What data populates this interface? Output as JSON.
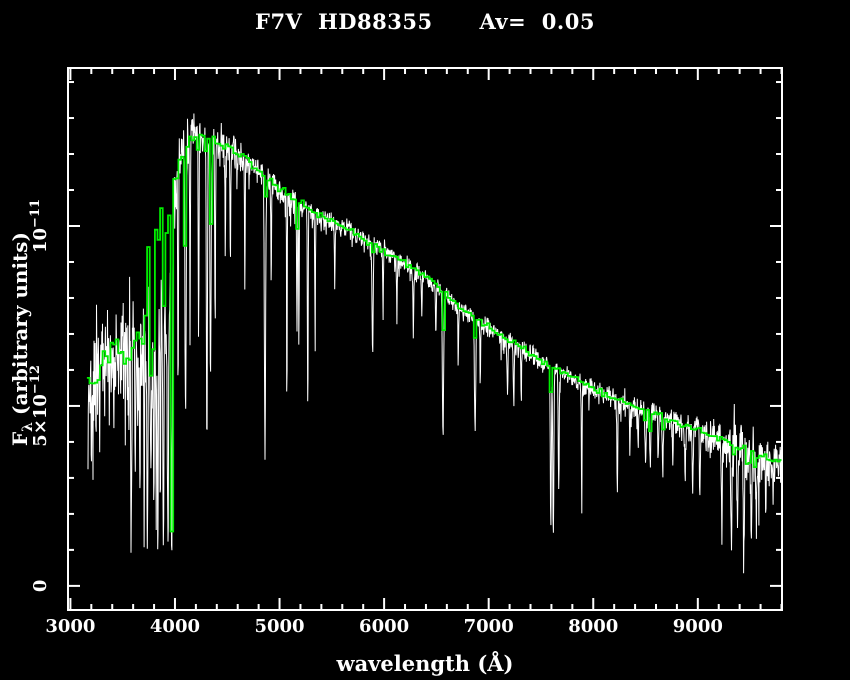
{
  "window": {
    "background": "#000000",
    "foreground": "#ffffff"
  },
  "chart_data": {
    "type": "line",
    "title": "F7V  HD88355      Av=  0.05",
    "xlabel": "wavelength (Å)",
    "ylabel_parts": [
      {
        "t": "F"
      },
      {
        "t": "λ",
        "sub": true
      },
      {
        "t": " (arbitrary units)"
      }
    ],
    "axis_color": "#ffffff",
    "background_color": "#000000",
    "x_range": [
      2977,
      9805
    ],
    "x_unit": "Å",
    "x_major_ticks": [
      {
        "value": 3000,
        "label": "3000"
      },
      {
        "value": 4000,
        "label": "4000"
      },
      {
        "value": 5000,
        "label": "5000"
      },
      {
        "value": 6000,
        "label": "6000"
      },
      {
        "value": 7000,
        "label": "7000"
      },
      {
        "value": 8000,
        "label": "8000"
      },
      {
        "value": 9000,
        "label": "9000"
      }
    ],
    "x_minor_step": 200,
    "y_range_1e12": [
      -0.67,
      14.39
    ],
    "y_major_ticks": [
      {
        "value": 0,
        "parts": [
          {
            "t": "0"
          }
        ]
      },
      {
        "value": 5,
        "parts": [
          {
            "t": "5×10"
          },
          {
            "t": "−12",
            "sup": true
          }
        ]
      },
      {
        "value": 10,
        "parts": [
          {
            "t": "10"
          },
          {
            "t": "−11",
            "sup": true
          }
        ]
      }
    ],
    "y_minor_step": 1,
    "y_minor_max": 14,
    "grid": false,
    "legend": false,
    "noise_seed": 7,
    "series": [
      {
        "name": "observed-spectrum",
        "color": "#ffffff",
        "style": "line",
        "stroke_width": 1,
        "start": 3168,
        "end": 9800,
        "sample_step_A": 3.4,
        "continuum_1e12": [
          [
            3168,
            5.0
          ],
          [
            3230,
            5.3
          ],
          [
            3300,
            5.8
          ],
          [
            3400,
            6.2
          ],
          [
            3500,
            6.4
          ],
          [
            3600,
            6.2
          ],
          [
            3700,
            6.6
          ],
          [
            3780,
            6.9
          ],
          [
            3860,
            7.1
          ],
          [
            3920,
            7.3
          ],
          [
            3960,
            8.6
          ],
          [
            4000,
            10.6
          ],
          [
            4040,
            11.8
          ],
          [
            4100,
            12.4
          ],
          [
            4160,
            12.7
          ],
          [
            4250,
            12.5
          ],
          [
            4350,
            12.3
          ],
          [
            4450,
            12.25
          ],
          [
            4550,
            12.1
          ],
          [
            4700,
            11.8
          ],
          [
            4850,
            11.4
          ],
          [
            5000,
            11.0
          ],
          [
            5200,
            10.6
          ],
          [
            5400,
            10.2
          ],
          [
            5600,
            10.0
          ],
          [
            5800,
            9.65
          ],
          [
            6000,
            9.3
          ],
          [
            6200,
            8.95
          ],
          [
            6450,
            8.45
          ],
          [
            6563,
            8.15
          ],
          [
            6700,
            7.75
          ],
          [
            6900,
            7.35
          ],
          [
            7100,
            7.0
          ],
          [
            7300,
            6.6
          ],
          [
            7500,
            6.25
          ],
          [
            7700,
            5.95
          ],
          [
            7900,
            5.6
          ],
          [
            8100,
            5.35
          ],
          [
            8300,
            5.1
          ],
          [
            8500,
            4.85
          ],
          [
            8700,
            4.6
          ],
          [
            8900,
            4.4
          ],
          [
            9100,
            4.15
          ],
          [
            9300,
            3.95
          ],
          [
            9500,
            3.7
          ],
          [
            9650,
            3.5
          ],
          [
            9800,
            3.4
          ]
        ],
        "noise_amplitude_1e12": [
          [
            3168,
            1.9
          ],
          [
            3500,
            2.0
          ],
          [
            3800,
            1.9
          ],
          [
            3950,
            1.5
          ],
          [
            4050,
            0.8
          ],
          [
            4200,
            0.55
          ],
          [
            4600,
            0.45
          ],
          [
            5000,
            0.38
          ],
          [
            5500,
            0.33
          ],
          [
            6000,
            0.3
          ],
          [
            6500,
            0.28
          ],
          [
            7000,
            0.3
          ],
          [
            7400,
            0.32
          ],
          [
            7800,
            0.35
          ],
          [
            8200,
            0.35
          ],
          [
            8700,
            0.4
          ],
          [
            9000,
            0.5
          ],
          [
            9200,
            0.7
          ],
          [
            9350,
            1.0
          ],
          [
            9550,
            1.0
          ],
          [
            9700,
            0.75
          ],
          [
            9800,
            0.6
          ]
        ],
        "absorption_lines": [
          [
            3581,
            1.3,
            6
          ],
          [
            3620,
            2.6,
            5
          ],
          [
            3664,
            2.9,
            5
          ],
          [
            3706,
            2.3,
            5
          ],
          [
            3735,
            1.1,
            6
          ],
          [
            3770,
            2.2,
            6
          ],
          [
            3798,
            2.0,
            6
          ],
          [
            3820,
            2.8,
            5
          ],
          [
            3835,
            1.6,
            6
          ],
          [
            3860,
            3.0,
            5
          ],
          [
            3889,
            1.2,
            7
          ],
          [
            3933,
            0.7,
            8
          ],
          [
            3968,
            1.0,
            8
          ],
          [
            4030,
            5.2,
            5
          ],
          [
            4101,
            4.8,
            8
          ],
          [
            4144,
            7.8,
            5
          ],
          [
            4226,
            6.8,
            5
          ],
          [
            4305,
            3.8,
            7
          ],
          [
            4340,
            5.9,
            8
          ],
          [
            4384,
            7.0,
            5
          ],
          [
            4481,
            9.2,
            4
          ],
          [
            4530,
            8.7,
            4
          ],
          [
            4668,
            8.2,
            4
          ],
          [
            4861,
            3.4,
            8
          ],
          [
            4920,
            8.2,
            4
          ],
          [
            5070,
            4.5,
            4
          ],
          [
            5167,
            7.0,
            5
          ],
          [
            5185,
            6.7,
            4
          ],
          [
            5270,
            5.2,
            5
          ],
          [
            5340,
            6.7,
            4
          ],
          [
            5528,
            8.0,
            4
          ],
          [
            5890,
            6.4,
            7
          ],
          [
            5990,
            7.4,
            4
          ],
          [
            6122,
            7.3,
            4
          ],
          [
            6280,
            7.0,
            5
          ],
          [
            6360,
            7.4,
            4
          ],
          [
            6495,
            6.7,
            5
          ],
          [
            6563,
            4.1,
            8
          ],
          [
            6710,
            6.3,
            4
          ],
          [
            6870,
            4.2,
            8
          ],
          [
            6920,
            5.7,
            5
          ],
          [
            7180,
            5.3,
            6
          ],
          [
            7240,
            5.1,
            6
          ],
          [
            7310,
            5.4,
            5
          ],
          [
            7594,
            1.5,
            7
          ],
          [
            7618,
            1.4,
            8
          ],
          [
            7670,
            2.6,
            6
          ],
          [
            7890,
            2.4,
            5
          ],
          [
            8230,
            2.8,
            6
          ],
          [
            8350,
            3.7,
            5
          ],
          [
            8430,
            3.9,
            5
          ],
          [
            8500,
            3.4,
            6
          ],
          [
            8545,
            3.2,
            7
          ],
          [
            8620,
            3.6,
            5
          ],
          [
            8665,
            3.1,
            7
          ],
          [
            8760,
            3.3,
            5
          ],
          [
            8880,
            3.0,
            5
          ],
          [
            8950,
            2.5,
            6
          ],
          [
            9020,
            2.8,
            5
          ],
          [
            9230,
            2.1,
            7
          ],
          [
            9320,
            1.3,
            8
          ],
          [
            9380,
            1.6,
            7
          ],
          [
            9440,
            1.2,
            8
          ],
          [
            9510,
            1.7,
            7
          ],
          [
            9560,
            1.4,
            7
          ],
          [
            9650,
            2.3,
            5
          ],
          [
            9720,
            2.7,
            4
          ]
        ]
      },
      {
        "name": "template-spectrum",
        "color": "#00ee00",
        "style": "step",
        "stroke_width": 1.8,
        "start": 3158,
        "end": 9800,
        "bin_A": 25,
        "continuum_1e12": [
          [
            3158,
            5.8
          ],
          [
            3210,
            5.4
          ],
          [
            3280,
            6.0
          ],
          [
            3360,
            6.4
          ],
          [
            3430,
            6.8
          ],
          [
            3500,
            6.5
          ],
          [
            3560,
            6.2
          ],
          [
            3640,
            6.8
          ],
          [
            3710,
            7.0
          ],
          [
            3750,
            9.4
          ],
          [
            3800,
            10.0
          ],
          [
            3850,
            10.2
          ],
          [
            3900,
            10.4
          ],
          [
            3945,
            10.9
          ],
          [
            3990,
            11.2
          ],
          [
            4060,
            11.8
          ],
          [
            4150,
            12.4
          ],
          [
            4300,
            12.5
          ],
          [
            4450,
            12.3
          ],
          [
            4600,
            12.0
          ],
          [
            4800,
            11.6
          ],
          [
            5000,
            11.05
          ],
          [
            5200,
            10.65
          ],
          [
            5400,
            10.25
          ],
          [
            5600,
            10.0
          ],
          [
            5800,
            9.65
          ],
          [
            6000,
            9.3
          ],
          [
            6200,
            9.0
          ],
          [
            6450,
            8.5
          ],
          [
            6563,
            8.2
          ],
          [
            6700,
            7.8
          ],
          [
            6900,
            7.4
          ],
          [
            7100,
            7.0
          ],
          [
            7300,
            6.65
          ],
          [
            7500,
            6.25
          ],
          [
            7700,
            5.95
          ],
          [
            7900,
            5.65
          ],
          [
            8100,
            5.35
          ],
          [
            8300,
            5.1
          ],
          [
            8500,
            4.9
          ],
          [
            8700,
            4.65
          ],
          [
            8900,
            4.45
          ],
          [
            9100,
            4.2
          ],
          [
            9300,
            4.0
          ],
          [
            9500,
            3.75
          ],
          [
            9650,
            3.55
          ],
          [
            9800,
            3.45
          ]
        ],
        "noise_amplitude_1e12": [
          [
            3158,
            0.35
          ],
          [
            3740,
            0.5
          ],
          [
            3960,
            0.3
          ],
          [
            4100,
            0.25
          ],
          [
            4500,
            0.18
          ],
          [
            5000,
            0.15
          ],
          [
            6000,
            0.12
          ],
          [
            7000,
            0.1
          ],
          [
            8000,
            0.1
          ],
          [
            9000,
            0.12
          ],
          [
            9800,
            0.12
          ]
        ],
        "absorption_lines": [
          [
            3770,
            6.1,
            5
          ],
          [
            3798,
            5.7,
            5
          ],
          [
            3835,
            5.2,
            6
          ],
          [
            3889,
            4.6,
            7
          ],
          [
            3933,
            1.1,
            8
          ],
          [
            3970,
            1.5,
            8
          ],
          [
            4101,
            8.6,
            9
          ],
          [
            4227,
            10.6,
            5
          ],
          [
            4305,
            10.4,
            7
          ],
          [
            4340,
            8.9,
            9
          ],
          [
            4861,
            9.7,
            9
          ],
          [
            5167,
            9.6,
            6
          ],
          [
            5890,
            9.0,
            7
          ],
          [
            6563,
            6.3,
            10
          ],
          [
            6870,
            6.9,
            6
          ],
          [
            7180,
            6.3,
            7
          ],
          [
            7600,
            5.3,
            12
          ],
          [
            8500,
            4.4,
            6
          ],
          [
            8545,
            4.3,
            7
          ],
          [
            8665,
            4.1,
            7
          ],
          [
            9350,
            3.6,
            15
          ],
          [
            9480,
            3.2,
            18
          ],
          [
            9550,
            3.25,
            15
          ]
        ]
      }
    ]
  }
}
